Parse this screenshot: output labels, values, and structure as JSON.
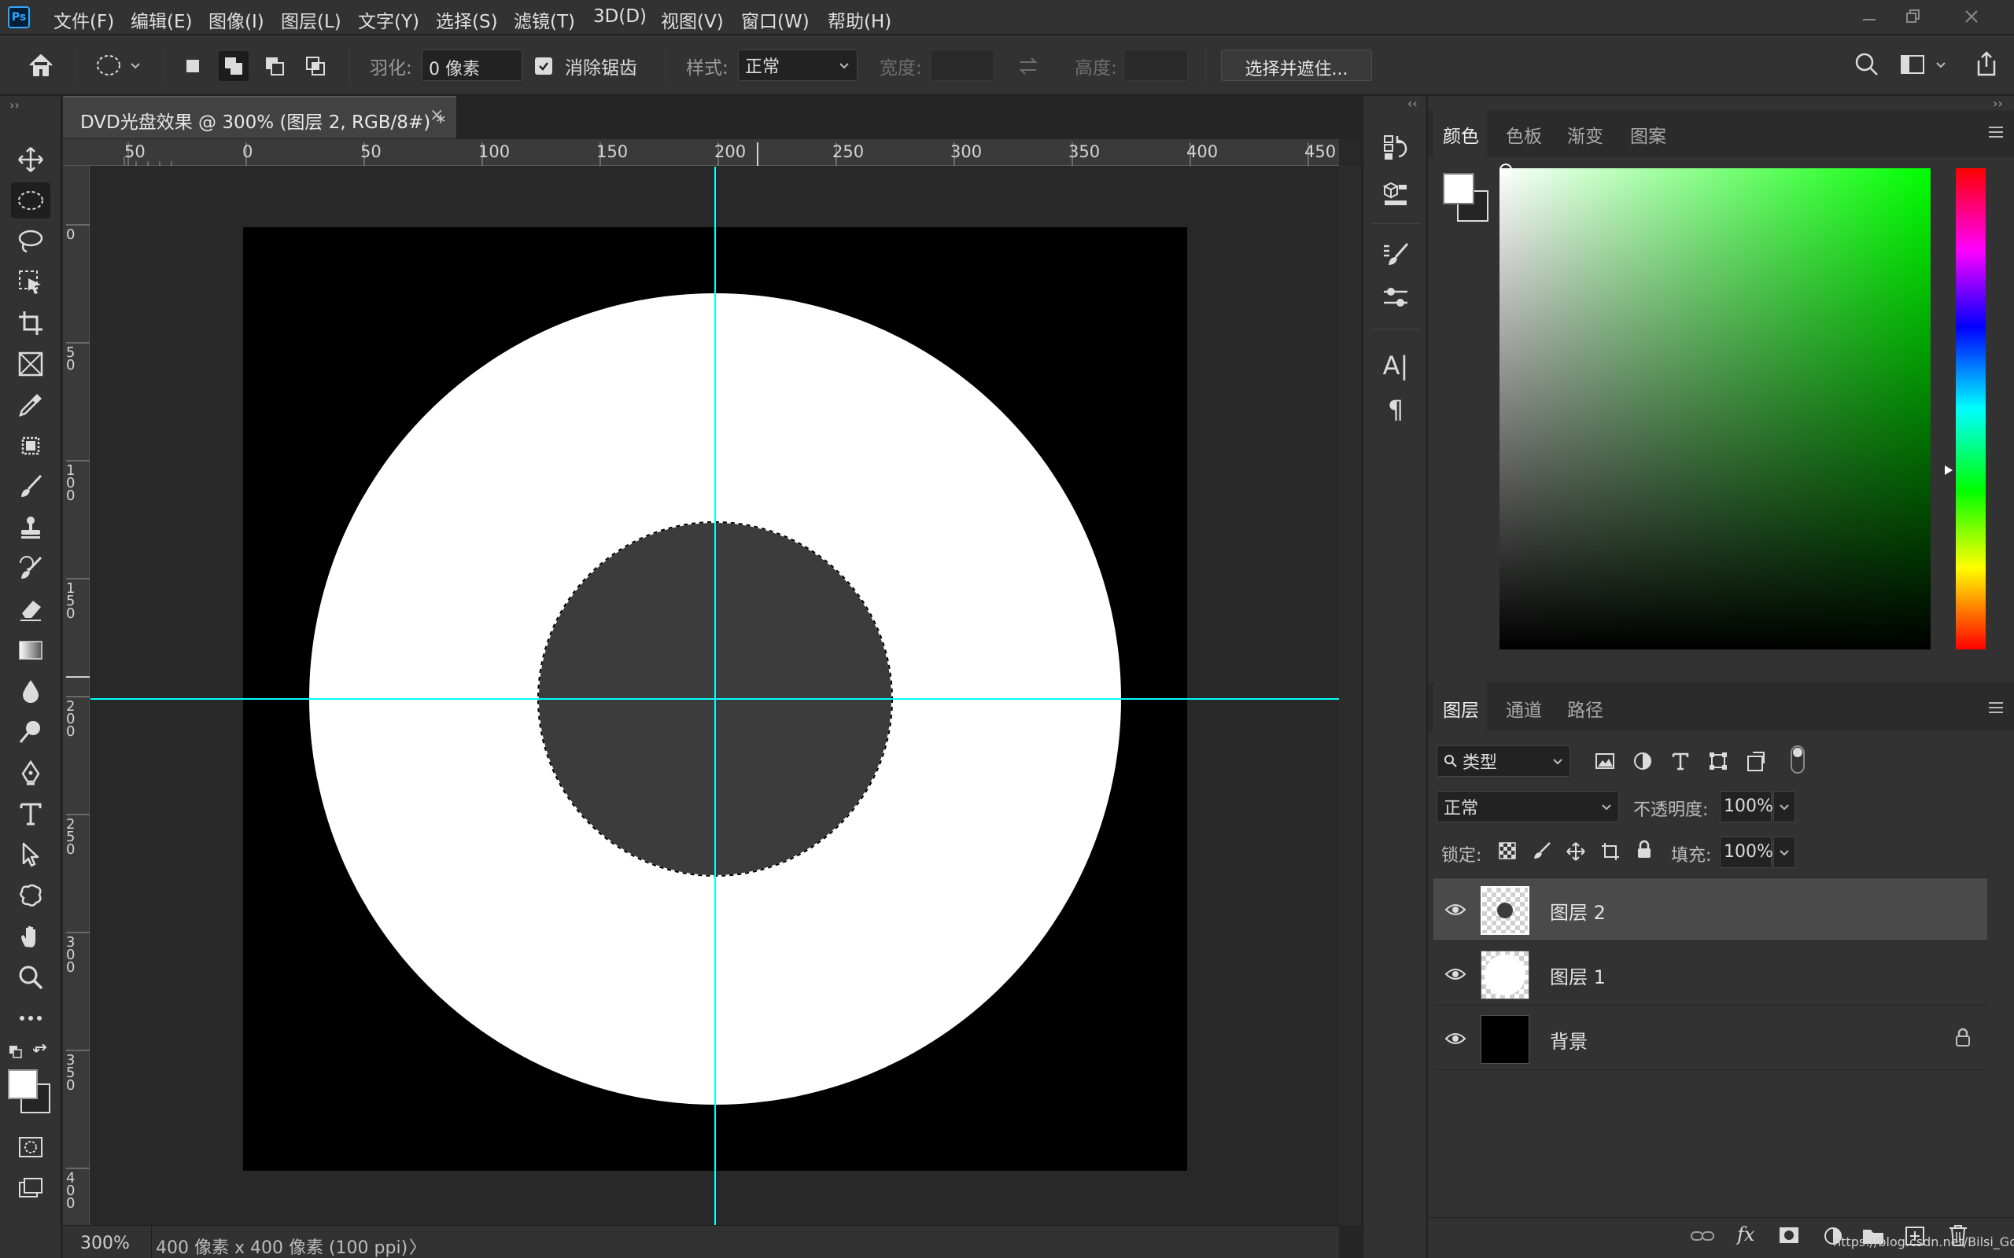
{
  "app": {
    "logo_text": "Ps"
  },
  "menu": {
    "items": [
      "文件(F)",
      "编辑(E)",
      "图像(I)",
      "图层(L)",
      "文字(Y)",
      "选择(S)",
      "滤镜(T)",
      "3D(D)",
      "视图(V)",
      "窗口(W)",
      "帮助(H)"
    ]
  },
  "options": {
    "feather_label": "羽化:",
    "feather_value": "0 像素",
    "antialias_label": "消除锯齿",
    "antialias_checked": true,
    "style_label": "样式:",
    "style_value": "正常",
    "width_label": "宽度:",
    "height_label": "高度:",
    "select_mask_button": "选择并遮住..."
  },
  "document": {
    "tab_title": "DVD光盘效果 @ 300% (图层 2, RGB/8#) *",
    "close_glyph": "×"
  },
  "rulers": {
    "top_labels": [
      "50",
      "0",
      "50",
      "100",
      "150",
      "200",
      "250",
      "300",
      "350",
      "400",
      "450"
    ],
    "left_labels": [
      [
        "0"
      ],
      [
        "5",
        "0"
      ],
      [
        "1",
        "0",
        "0"
      ],
      [
        "1",
        "5",
        "0"
      ],
      [
        "2",
        "0",
        "0"
      ],
      [
        "2",
        "5",
        "0"
      ],
      [
        "3",
        "0",
        "0"
      ],
      [
        "3",
        "5",
        "0"
      ],
      [
        "4",
        "0",
        "0"
      ]
    ]
  },
  "status": {
    "zoom": "300%",
    "doc_info": "400 像素 x 400 像素 (100 ppi)",
    "arrow": "〉"
  },
  "color_panel": {
    "tabs": [
      "颜色",
      "色板",
      "渐变",
      "图案"
    ],
    "active_tab": "颜色",
    "hue_color": "#00ff00",
    "foreground": "#ffffff",
    "background": "#252525"
  },
  "layers_panel": {
    "tabs": [
      "图层",
      "通道",
      "路径"
    ],
    "active_tab": "图层",
    "filter_label": "类型",
    "blend_mode": "正常",
    "opacity_label": "不透明度:",
    "opacity_value": "100%",
    "lock_label": "锁定:",
    "fill_label": "填充:",
    "fill_value": "100%",
    "layers": [
      {
        "name": "图层 2",
        "selected": true,
        "visible": true,
        "locked": false
      },
      {
        "name": "图层 1",
        "selected": false,
        "visible": true,
        "locked": false
      },
      {
        "name": "背景",
        "selected": false,
        "visible": true,
        "locked": true
      }
    ],
    "watermark": "https://blog.csdn.net/Bilsi_God"
  },
  "colors": {
    "guide": "#00ffff",
    "disc": "#ffffff",
    "hole": "#3c3c3c",
    "document_bg": "#000000"
  }
}
